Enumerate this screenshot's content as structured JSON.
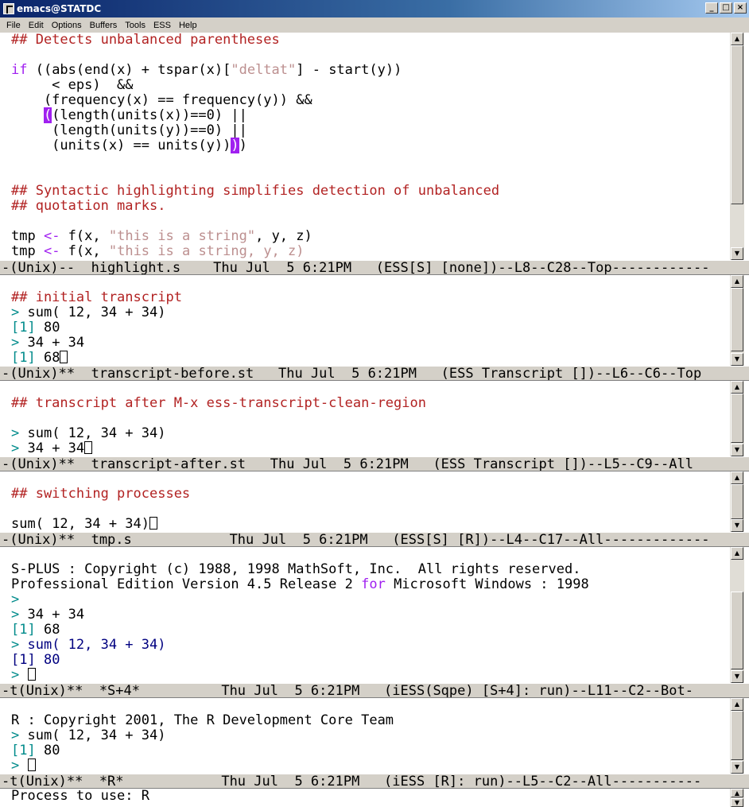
{
  "window": {
    "title": "emacs@STATDC",
    "buttons": [
      "_",
      "□",
      "×"
    ]
  },
  "menu": [
    "File",
    "Edit",
    "Options",
    "Buffers",
    "Tools",
    "ESS",
    "Help"
  ],
  "pane1": {
    "l1": "## Detects unbalanced parentheses",
    "l3_kw": "if",
    "l3_a": " ((abs(end(x) + tspar(x)[",
    "l3_str": "\"deltat\"",
    "l3_b": "] - start(y))",
    "l4": "     < eps)  &&",
    "l5": "    (frequency(x) == frequency(y)) &&",
    "l6_pre": "    ",
    "l6_match": "(",
    "l6_post": "(length(units(x))==0) ||",
    "l7": "     (length(units(y))==0) ||",
    "l8_pre": "     (units(x) == units(y))",
    "l8_match": ")",
    "l8_post": ")",
    "l11": "## Syntactic highlighting simplifies detection of unbalanced",
    "l12": "## quotation marks.",
    "l14_a": "tmp ",
    "l14_op": "<-",
    "l14_b": " f(x, ",
    "l14_str": "\"this is a string\"",
    "l14_c": ", y, z)",
    "l15_a": "tmp ",
    "l15_op": "<-",
    "l15_b": " f(x, ",
    "l15_str": "\"this is a string, y, z)"
  },
  "modeline1": "-(Unix)--  highlight.s    Thu Jul  5 6:21PM   (ESS[S] [none])--L8--C28--Top------------",
  "pane2": {
    "l1": "## initial transcript",
    "prompt": ">",
    "l2": " sum( 12, 34 + 34)",
    "l3_idx": "[1]",
    "l3_val": " 80",
    "l4": " 34 + 34",
    "l5_idx": "[1]",
    "l5_val": " 68"
  },
  "modeline2": "-(Unix)**  transcript-before.st   Thu Jul  5 6:21PM   (ESS Transcript [])--L6--C6--Top",
  "pane3": {
    "l1": "## transcript after M-x ess-transcript-clean-region",
    "prompt": ">",
    "l3": " sum( 12, 34 + 34)",
    "l4": " 34 + 34"
  },
  "modeline3": "-(Unix)**  transcript-after.st   Thu Jul  5 6:21PM   (ESS Transcript [])--L5--C9--All",
  "pane4": {
    "l1": "## switching processes",
    "l3": "sum( 12, 34 + 34)"
  },
  "modeline4": "-(Unix)**  tmp.s            Thu Jul  5 6:21PM   (ESS[S] [R])--L4--C17--All-------------",
  "pane5": {
    "l1": "S-PLUS : Copyright (c) 1988, 1998 MathSoft, Inc.  All rights reserved.",
    "l2_a": "Professional Edition Version 4.5 Release 2 ",
    "l2_kw": "for",
    "l2_b": " Microsoft Windows : 1998",
    "prompt": ">",
    "l4": " 34 + 34",
    "l5_idx": "[1]",
    "l5_val": " 68",
    "l6": " sum( 12, 34 + 34)",
    "l7_idx": "[1]",
    "l7_val": " 80"
  },
  "modeline5": "-t(Unix)**  *S+4*          Thu Jul  5 6:21PM   (iESS(Sqpe) [S+4]: run)--L11--C2--Bot-",
  "pane6": {
    "l1": "R : Copyright 2001, The R Development Core Team",
    "prompt": ">",
    "l2": " sum( 12, 34 + 34)",
    "l3_idx": "[1]",
    "l3_val": " 80"
  },
  "modeline6": "-t(Unix)**  *R*            Thu Jul  5 6:21PM   (iESS [R]: run)--L5--C2--All-----------",
  "minibuffer": "Process to use: R"
}
